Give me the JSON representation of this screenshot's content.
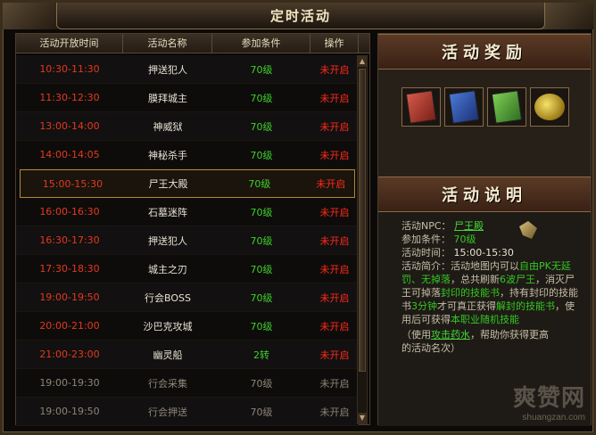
{
  "window": {
    "title": "定时活动"
  },
  "table": {
    "headers": [
      "活动开放时间",
      "活动名称",
      "参加条件",
      "操作"
    ],
    "rows": [
      {
        "time": "10:30-11:30",
        "name": "押送犯人",
        "cond": "70级",
        "op": "未开启"
      },
      {
        "time": "11:30-12:30",
        "name": "膜拜城主",
        "cond": "70级",
        "op": "未开启"
      },
      {
        "time": "13:00-14:00",
        "name": "神威狱",
        "cond": "70级",
        "op": "未开启"
      },
      {
        "time": "14:00-14:05",
        "name": "神秘杀手",
        "cond": "70级",
        "op": "未开启"
      },
      {
        "time": "15:00-15:30",
        "name": "尸王大殿",
        "cond": "70级",
        "op": "未开启"
      },
      {
        "time": "16:00-16:30",
        "name": "石墓迷阵",
        "cond": "70级",
        "op": "未开启"
      },
      {
        "time": "16:30-17:30",
        "name": "押送犯人",
        "cond": "70级",
        "op": "未开启"
      },
      {
        "time": "17:30-18:30",
        "name": "城主之刃",
        "cond": "70级",
        "op": "未开启"
      },
      {
        "time": "19:00-19:50",
        "name": "行会BOSS",
        "cond": "70级",
        "op": "未开启"
      },
      {
        "time": "20:00-21:00",
        "name": "沙巴克攻城",
        "cond": "70级",
        "op": "未开启"
      },
      {
        "time": "21:00-23:00",
        "name": "幽灵船",
        "cond": "2转",
        "op": "未开启"
      },
      {
        "time": "19:00-19:30",
        "name": "行会采集",
        "cond": "70级",
        "op": "未开启"
      },
      {
        "time": "19:00-19:50",
        "name": "行会押送",
        "cond": "70级",
        "op": "未开启"
      }
    ]
  },
  "rewards": {
    "header": "活动奖励",
    "items": [
      {
        "icon": "red-skill-book-icon",
        "color": "#c8453a"
      },
      {
        "icon": "blue-skill-book-icon",
        "color": "#3a60c0"
      },
      {
        "icon": "green-skill-book-icon",
        "color": "#5aa83a"
      },
      {
        "icon": "gold-coins-icon",
        "color": "#d8b63a"
      }
    ]
  },
  "description": {
    "header": "活动说明",
    "npc_label": "活动NPC：",
    "npc_value": "尸王殿",
    "cond_label": "参加条件：",
    "cond_value": "70级",
    "time_label": "活动时间：",
    "time_value": "15:00-15:30",
    "intro_label": "活动简介：",
    "intro_1": "活动地图内可以",
    "intro_free_pk": "自由PK无",
    "intro_2": "延罚、无掉落",
    "intro_3": "，总共刷新",
    "intro_waves": "6波尸王",
    "intro_4": "，消",
    "intro_5": "灭尸王可掉落",
    "intro_seal": "封印的技能书",
    "intro_6": "，持有封",
    "intro_7": "印的技能书",
    "intro_3min": "3分钟",
    "intro_8": "才可真正获得",
    "intro_unseal": "解封的",
    "intro_9": "技能书",
    "intro_10": "，使用后可获得",
    "intro_random": "本职业随机技",
    "intro_11": "能",
    "tip_1": "（使用",
    "tip_link": "攻击药水",
    "tip_2": "，帮助你获得更高",
    "tip_3": "的活动名次）"
  },
  "watermark": {
    "big": "爽赞网",
    "small": "shuangzan.com"
  },
  "colors": {
    "time_red": "#e23a1f",
    "cond_green": "#3ed12a",
    "op_red": "#ff2a1a",
    "disabled_gray": "#8c8677"
  }
}
